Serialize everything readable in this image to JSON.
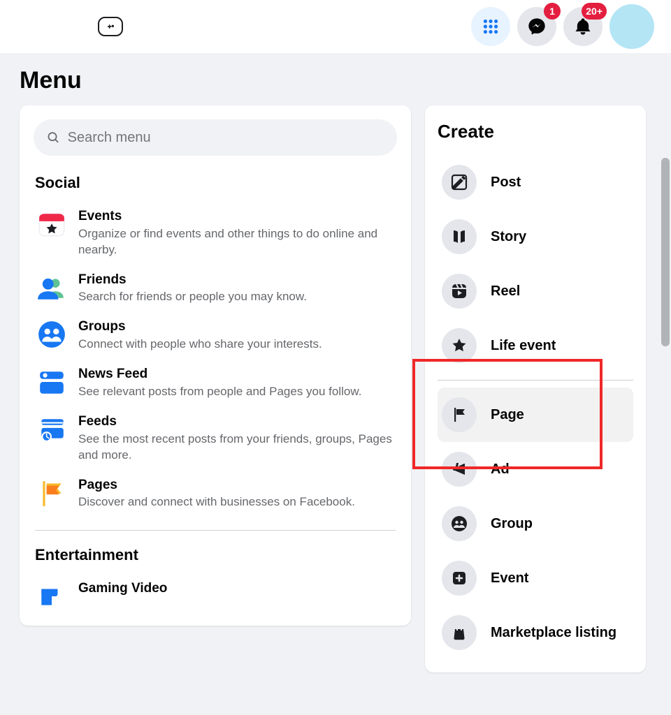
{
  "header": {
    "messenger_badge": "1",
    "notifications_badge": "20+"
  },
  "page_title": "Menu",
  "search": {
    "placeholder": "Search menu"
  },
  "sections": [
    {
      "heading": "Social",
      "items": [
        {
          "title": "Events",
          "desc": "Organize or find events and other things to do online and nearby."
        },
        {
          "title": "Friends",
          "desc": "Search for friends or people you may know."
        },
        {
          "title": "Groups",
          "desc": "Connect with people who share your interests."
        },
        {
          "title": "News Feed",
          "desc": "See relevant posts from people and Pages you follow."
        },
        {
          "title": "Feeds",
          "desc": "See the most recent posts from your friends, groups, Pages and more."
        },
        {
          "title": "Pages",
          "desc": "Discover and connect with businesses on Facebook."
        }
      ]
    },
    {
      "heading": "Entertainment",
      "items": [
        {
          "title": "Gaming Video",
          "desc": ""
        }
      ]
    }
  ],
  "create": {
    "title": "Create",
    "items": [
      {
        "label": "Post"
      },
      {
        "label": "Story"
      },
      {
        "label": "Reel"
      },
      {
        "label": "Life event"
      },
      {
        "label": "Page"
      },
      {
        "label": "Ad"
      },
      {
        "label": "Group"
      },
      {
        "label": "Event"
      },
      {
        "label": "Marketplace listing"
      }
    ]
  }
}
